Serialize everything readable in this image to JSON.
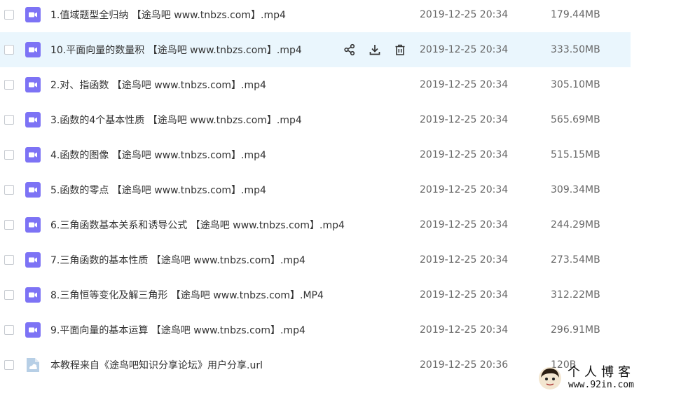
{
  "colors": {
    "hover_row": "#eaf6fd",
    "video_icon": "#7d73f5",
    "url_icon": "#b7cfe6"
  },
  "files": [
    {
      "name": "1.值域题型全归纳 【途鸟吧 www.tnbzs.com】.mp4",
      "date": "2019-12-25 20:34",
      "size": "179.44MB",
      "icon": "video-file-icon"
    },
    {
      "name": "10.平面向量的数量积 【途鸟吧 www.tnbzs.com】.mp4",
      "date": "2019-12-25 20:34",
      "size": "333.50MB",
      "icon": "video-file-icon",
      "hovered": true
    },
    {
      "name": "2.对、指函数 【途鸟吧 www.tnbzs.com】.mp4",
      "date": "2019-12-25 20:34",
      "size": "305.10MB",
      "icon": "video-file-icon"
    },
    {
      "name": "3.函数的4个基本性质 【途鸟吧 www.tnbzs.com】.mp4",
      "date": "2019-12-25 20:34",
      "size": "565.69MB",
      "icon": "video-file-icon"
    },
    {
      "name": "4.函数的图像 【途鸟吧 www.tnbzs.com】.mp4",
      "date": "2019-12-25 20:34",
      "size": "515.15MB",
      "icon": "video-file-icon"
    },
    {
      "name": "5.函数的零点 【途鸟吧 www.tnbzs.com】.mp4",
      "date": "2019-12-25 20:34",
      "size": "309.34MB",
      "icon": "video-file-icon"
    },
    {
      "name": "6.三角函数基本关系和诱导公式 【途鸟吧 www.tnbzs.com】.mp4",
      "date": "2019-12-25 20:34",
      "size": "244.29MB",
      "icon": "video-file-icon"
    },
    {
      "name": "7.三角函数的基本性质 【途鸟吧 www.tnbzs.com】.mp4",
      "date": "2019-12-25 20:34",
      "size": "273.54MB",
      "icon": "video-file-icon"
    },
    {
      "name": "8.三角恒等变化及解三角形 【途鸟吧 www.tnbzs.com】.MP4",
      "date": "2019-12-25 20:34",
      "size": "312.22MB",
      "icon": "video-file-icon"
    },
    {
      "name": "9.平面向量的基本运算 【途鸟吧 www.tnbzs.com】.mp4",
      "date": "2019-12-25 20:34",
      "size": "296.91MB",
      "icon": "video-file-icon"
    },
    {
      "name": "本教程来自《途鸟吧知识分享论坛》用户分享.url",
      "date": "2019-12-25 20:36",
      "size": "120B",
      "icon": "url-file-icon"
    }
  ],
  "row_actions": [
    "share-icon",
    "download-icon",
    "delete-icon"
  ],
  "watermark": {
    "title": "个人博客",
    "url": "www.92in.com"
  }
}
